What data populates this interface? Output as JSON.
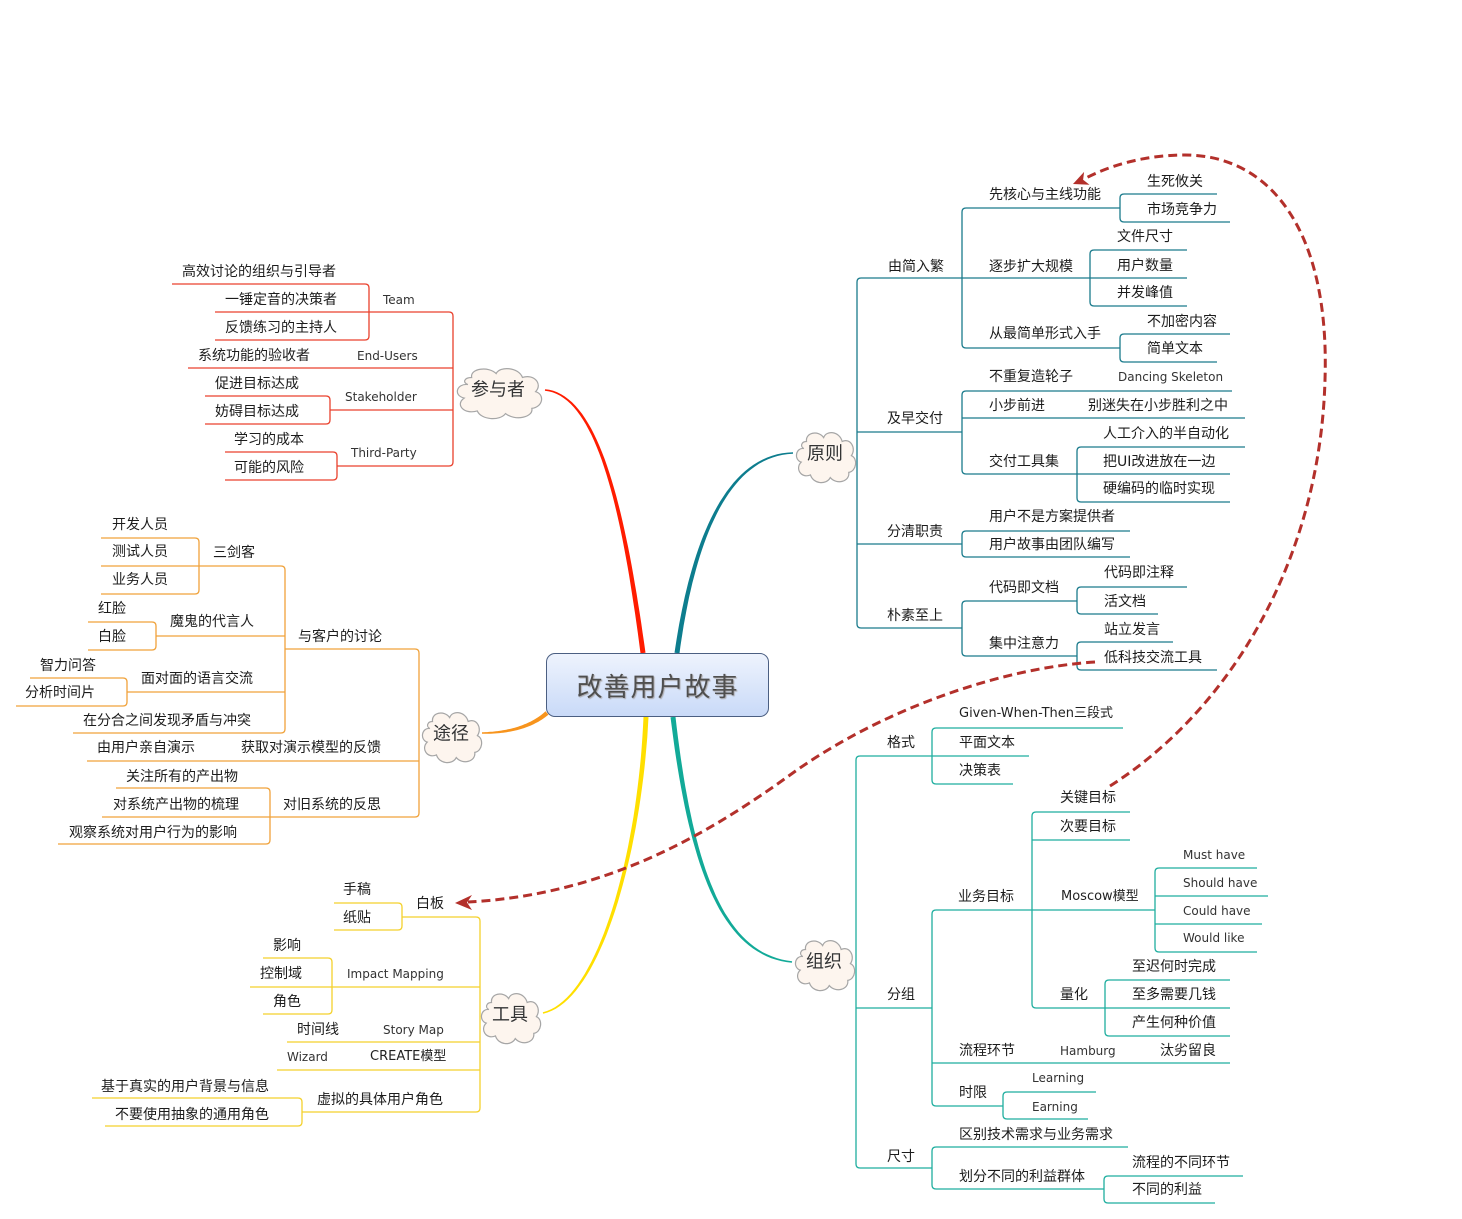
{
  "mindmap": {
    "central_topic": "改善用户故事",
    "branches": [
      {
        "label": "原则",
        "color": "#0d7d8e",
        "line_color": "#1a7b8c",
        "children": [
          {
            "label": "由简入繁",
            "children": [
              {
                "label": "先核心与主线功能",
                "children": [
                  "生死攸关",
                  "市场竞争力"
                ]
              },
              {
                "label": "逐步扩大规模",
                "children": [
                  "文件尺寸",
                  "用户数量",
                  "并发峰值"
                ]
              },
              {
                "label": "从最简单形式入手",
                "children": [
                  "不加密内容",
                  "简单文本"
                ]
              }
            ]
          },
          {
            "label": "及早交付",
            "children": [
              {
                "label": "不重复造轮子",
                "children": [
                  "Dancing Skeleton"
                ]
              },
              {
                "label": "小步前进",
                "children": [
                  "别迷失在小步胜利之中"
                ]
              },
              {
                "label": "交付工具集",
                "children": [
                  "人工介入的半自动化",
                  "把UI改进放在一边",
                  "硬编码的临时实现"
                ]
              }
            ]
          },
          {
            "label": "分清职责",
            "children": [
              "用户不是方案提供者",
              "用户故事由团队编写"
            ]
          },
          {
            "label": "朴素至上",
            "children": [
              {
                "label": "代码即文档",
                "children": [
                  "代码即注释",
                  "活文档"
                ]
              },
              {
                "label": "集中注意力",
                "children": [
                  "站立发言",
                  "低科技交流工具"
                ]
              }
            ]
          }
        ]
      },
      {
        "label": "组织",
        "color": "#12aa98",
        "line_color": "#1fae9f",
        "children": [
          {
            "label": "格式",
            "children": [
              "Given-When-Then三段式",
              "平面文本",
              "决策表"
            ]
          },
          {
            "label": "分组",
            "children": [
              {
                "label": "业务目标",
                "children": [
                  "关键目标",
                  "次要目标",
                  {
                    "label": "Moscow模型",
                    "children": [
                      "Must have",
                      "Should have",
                      "Could have",
                      "Would like"
                    ]
                  },
                  {
                    "label": "量化",
                    "children": [
                      "至迟何时完成",
                      "至多需要几钱",
                      "产生何种价值"
                    ]
                  }
                ]
              },
              {
                "label": "流程环节",
                "children": [
                  {
                    "label": "Hamburg",
                    "children": [
                      "汰劣留良"
                    ]
                  }
                ]
              },
              {
                "label": "时限",
                "children": [
                  "Learning",
                  "Earning"
                ]
              }
            ]
          },
          {
            "label": "尺寸",
            "children": [
              "区别技术需求与业务需求",
              {
                "label": "划分不同的利益群体",
                "children": [
                  "流程的不同环节",
                  "不同的利益"
                ]
              }
            ]
          }
        ]
      },
      {
        "label": "工具",
        "color": "#ffdf00",
        "line_color": "#f4d12c",
        "children": [
          {
            "label": "白板",
            "children": [
              "手稿",
              "纸贴"
            ]
          },
          {
            "label": "Impact Mapping",
            "children": [
              "影响",
              "控制域",
              "角色"
            ]
          },
          {
            "label": "Story Map",
            "children": [
              "时间线"
            ]
          },
          {
            "label": "CREATE模型",
            "children": [
              "Wizard"
            ]
          },
          {
            "label": "虚拟的具体用户角色",
            "children": [
              "基于真实的用户背景与信息",
              "不要使用抽象的通用角色"
            ]
          }
        ]
      },
      {
        "label": "途径",
        "color": "#f7941d",
        "line_color": "#f0a23b",
        "children": [
          {
            "label": "与客户的讨论",
            "children": [
              {
                "label": "三剑客",
                "children": [
                  "开发人员",
                  "测试人员",
                  "业务人员"
                ]
              },
              {
                "label": "魔鬼的代言人",
                "children": [
                  "红脸",
                  "白脸"
                ]
              },
              {
                "label": "面对面的语言交流",
                "children": [
                  "智力问答",
                  "分析时间片"
                ]
              },
              "在分合之间发现矛盾与冲突"
            ]
          },
          {
            "label": "获取对演示模型的反馈",
            "children": [
              "由用户亲自演示"
            ]
          },
          {
            "label": "对旧系统的反思",
            "children": [
              "关注所有的产出物",
              "对系统产出物的梳理",
              "观察系统对用户行为的影响"
            ]
          }
        ]
      },
      {
        "label": "参与者",
        "color": "#ff1c00",
        "line_color": "#e9412d",
        "children": [
          {
            "label": "Team",
            "children": [
              "高效讨论的组织与引导者",
              "一锤定音的决策者",
              "反馈练习的主持人"
            ]
          },
          {
            "label": "End-Users",
            "children": [
              "系统功能的验收者"
            ]
          },
          {
            "label": "Stakeholder",
            "children": [
              "促进目标达成",
              "妨碍目标达成"
            ]
          },
          {
            "label": "Third-Party",
            "children": [
              "学习的成本",
              "可能的风险"
            ]
          }
        ]
      }
    ]
  },
  "relationships": [
    {
      "from": "低科技交流工具",
      "to": "白板",
      "color": "#b3302b"
    },
    {
      "from": "关键目标",
      "to": "先核心与主线功能",
      "color": "#b3302b"
    }
  ]
}
